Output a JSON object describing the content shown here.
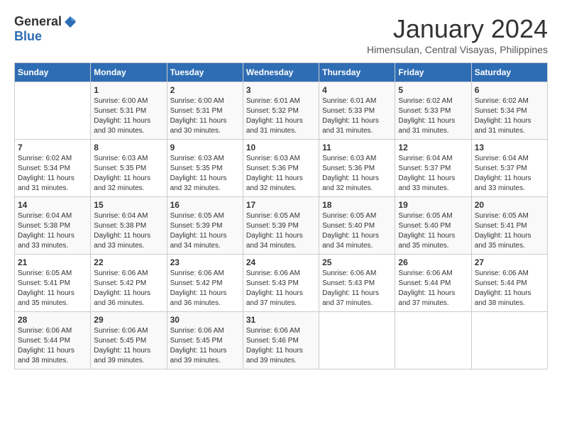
{
  "logo": {
    "general": "General",
    "blue": "Blue"
  },
  "title": "January 2024",
  "location": "Himensulan, Central Visayas, Philippines",
  "headers": [
    "Sunday",
    "Monday",
    "Tuesday",
    "Wednesday",
    "Thursday",
    "Friday",
    "Saturday"
  ],
  "weeks": [
    [
      {
        "day": "",
        "info": ""
      },
      {
        "day": "1",
        "info": "Sunrise: 6:00 AM\nSunset: 5:31 PM\nDaylight: 11 hours and 30 minutes."
      },
      {
        "day": "2",
        "info": "Sunrise: 6:00 AM\nSunset: 5:31 PM\nDaylight: 11 hours and 30 minutes."
      },
      {
        "day": "3",
        "info": "Sunrise: 6:01 AM\nSunset: 5:32 PM\nDaylight: 11 hours and 31 minutes."
      },
      {
        "day": "4",
        "info": "Sunrise: 6:01 AM\nSunset: 5:33 PM\nDaylight: 11 hours and 31 minutes."
      },
      {
        "day": "5",
        "info": "Sunrise: 6:02 AM\nSunset: 5:33 PM\nDaylight: 11 hours and 31 minutes."
      },
      {
        "day": "6",
        "info": "Sunrise: 6:02 AM\nSunset: 5:34 PM\nDaylight: 11 hours and 31 minutes."
      }
    ],
    [
      {
        "day": "7",
        "info": "Sunrise: 6:02 AM\nSunset: 5:34 PM\nDaylight: 11 hours and 31 minutes."
      },
      {
        "day": "8",
        "info": "Sunrise: 6:03 AM\nSunset: 5:35 PM\nDaylight: 11 hours and 32 minutes."
      },
      {
        "day": "9",
        "info": "Sunrise: 6:03 AM\nSunset: 5:35 PM\nDaylight: 11 hours and 32 minutes."
      },
      {
        "day": "10",
        "info": "Sunrise: 6:03 AM\nSunset: 5:36 PM\nDaylight: 11 hours and 32 minutes."
      },
      {
        "day": "11",
        "info": "Sunrise: 6:03 AM\nSunset: 5:36 PM\nDaylight: 11 hours and 32 minutes."
      },
      {
        "day": "12",
        "info": "Sunrise: 6:04 AM\nSunset: 5:37 PM\nDaylight: 11 hours and 33 minutes."
      },
      {
        "day": "13",
        "info": "Sunrise: 6:04 AM\nSunset: 5:37 PM\nDaylight: 11 hours and 33 minutes."
      }
    ],
    [
      {
        "day": "14",
        "info": "Sunrise: 6:04 AM\nSunset: 5:38 PM\nDaylight: 11 hours and 33 minutes."
      },
      {
        "day": "15",
        "info": "Sunrise: 6:04 AM\nSunset: 5:38 PM\nDaylight: 11 hours and 33 minutes."
      },
      {
        "day": "16",
        "info": "Sunrise: 6:05 AM\nSunset: 5:39 PM\nDaylight: 11 hours and 34 minutes."
      },
      {
        "day": "17",
        "info": "Sunrise: 6:05 AM\nSunset: 5:39 PM\nDaylight: 11 hours and 34 minutes."
      },
      {
        "day": "18",
        "info": "Sunrise: 6:05 AM\nSunset: 5:40 PM\nDaylight: 11 hours and 34 minutes."
      },
      {
        "day": "19",
        "info": "Sunrise: 6:05 AM\nSunset: 5:40 PM\nDaylight: 11 hours and 35 minutes."
      },
      {
        "day": "20",
        "info": "Sunrise: 6:05 AM\nSunset: 5:41 PM\nDaylight: 11 hours and 35 minutes."
      }
    ],
    [
      {
        "day": "21",
        "info": "Sunrise: 6:05 AM\nSunset: 5:41 PM\nDaylight: 11 hours and 35 minutes."
      },
      {
        "day": "22",
        "info": "Sunrise: 6:06 AM\nSunset: 5:42 PM\nDaylight: 11 hours and 36 minutes."
      },
      {
        "day": "23",
        "info": "Sunrise: 6:06 AM\nSunset: 5:42 PM\nDaylight: 11 hours and 36 minutes."
      },
      {
        "day": "24",
        "info": "Sunrise: 6:06 AM\nSunset: 5:43 PM\nDaylight: 11 hours and 37 minutes."
      },
      {
        "day": "25",
        "info": "Sunrise: 6:06 AM\nSunset: 5:43 PM\nDaylight: 11 hours and 37 minutes."
      },
      {
        "day": "26",
        "info": "Sunrise: 6:06 AM\nSunset: 5:44 PM\nDaylight: 11 hours and 37 minutes."
      },
      {
        "day": "27",
        "info": "Sunrise: 6:06 AM\nSunset: 5:44 PM\nDaylight: 11 hours and 38 minutes."
      }
    ],
    [
      {
        "day": "28",
        "info": "Sunrise: 6:06 AM\nSunset: 5:44 PM\nDaylight: 11 hours and 38 minutes."
      },
      {
        "day": "29",
        "info": "Sunrise: 6:06 AM\nSunset: 5:45 PM\nDaylight: 11 hours and 39 minutes."
      },
      {
        "day": "30",
        "info": "Sunrise: 6:06 AM\nSunset: 5:45 PM\nDaylight: 11 hours and 39 minutes."
      },
      {
        "day": "31",
        "info": "Sunrise: 6:06 AM\nSunset: 5:46 PM\nDaylight: 11 hours and 39 minutes."
      },
      {
        "day": "",
        "info": ""
      },
      {
        "day": "",
        "info": ""
      },
      {
        "day": "",
        "info": ""
      }
    ]
  ]
}
